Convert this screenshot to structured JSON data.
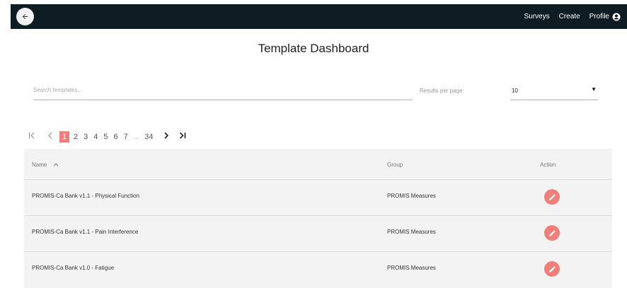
{
  "nav": {
    "surveys": "Surveys",
    "create": "Create",
    "profile": "Profile"
  },
  "page": {
    "title": "Template Dashboard"
  },
  "search": {
    "placeholder": "Search templates..."
  },
  "results_per_page": {
    "label": "Results per page:",
    "value": "10"
  },
  "pagination": {
    "current_page": "1",
    "pages": [
      "1",
      "2",
      "3",
      "4",
      "5",
      "6",
      "7"
    ],
    "ellipsis": "...",
    "last_page": "34"
  },
  "table": {
    "headers": {
      "name": "Name",
      "group": "Group",
      "action": "Action"
    },
    "rows": [
      {
        "name": "PROMIS-Ca Bank v1.1 - Physical Function",
        "group": "PROMIS Measures"
      },
      {
        "name": "PROMIS-Ca Bank v1.1 - Pain Interference",
        "group": "PROMIS Measures"
      },
      {
        "name": "PROMIS-Ca Bank v1.0 - Fatigue",
        "group": "PROMIS Measures"
      }
    ]
  },
  "colors": {
    "header_bg": "#0e1c24",
    "accent": "#f07f7b",
    "table_bg": "#f3f3f3"
  }
}
